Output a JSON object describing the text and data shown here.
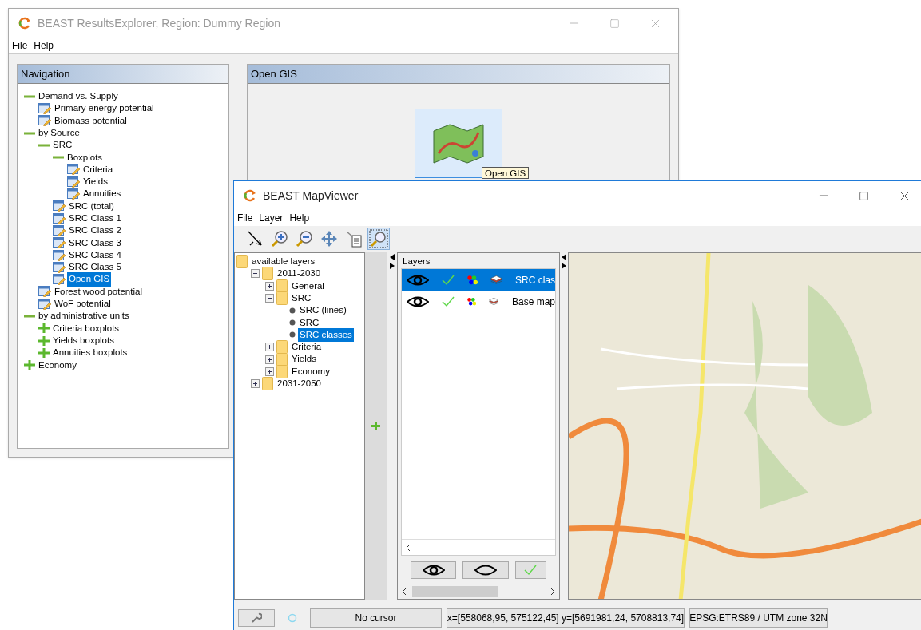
{
  "results_window": {
    "title": "BEAST ResultsExplorer, Region: Dummy Region",
    "menu": [
      "File",
      "Help"
    ],
    "navigation": {
      "title": "Navigation",
      "tree": [
        {
          "label": "Demand vs. Supply",
          "kind": "folder",
          "expanded": true,
          "selected": false,
          "children": [
            {
              "label": "Primary energy potential",
              "kind": "view",
              "selected": false
            },
            {
              "label": "Biomass potential",
              "kind": "view",
              "selected": false
            }
          ]
        },
        {
          "label": "by Source",
          "kind": "folder",
          "expanded": true,
          "selected": false,
          "children": [
            {
              "label": "SRC",
              "kind": "folder",
              "expanded": true,
              "selected": false,
              "children": [
                {
                  "label": "Boxplots",
                  "kind": "folder",
                  "expanded": true,
                  "selected": false,
                  "children": [
                    {
                      "label": "Criteria",
                      "kind": "view",
                      "selected": false
                    },
                    {
                      "label": "Yields",
                      "kind": "view",
                      "selected": false
                    },
                    {
                      "label": "Annuities",
                      "kind": "view",
                      "selected": false
                    }
                  ]
                },
                {
                  "label": "SRC (total)",
                  "kind": "view",
                  "selected": false
                },
                {
                  "label": "SRC Class 1",
                  "kind": "view",
                  "selected": false
                },
                {
                  "label": "SRC Class 2",
                  "kind": "view",
                  "selected": false
                },
                {
                  "label": "SRC Class 3",
                  "kind": "view",
                  "selected": false
                },
                {
                  "label": "SRC Class 4",
                  "kind": "view",
                  "selected": false
                },
                {
                  "label": "SRC Class 5",
                  "kind": "view",
                  "selected": false
                },
                {
                  "label": "Open GIS",
                  "kind": "view",
                  "selected": true
                }
              ]
            },
            {
              "label": "Forest wood potential",
              "kind": "view",
              "selected": false
            },
            {
              "label": "WoF potential",
              "kind": "view",
              "selected": false
            }
          ]
        },
        {
          "label": "by administrative units",
          "kind": "folder",
          "expanded": true,
          "selected": false,
          "children": [
            {
              "label": "Criteria boxplots",
              "kind": "folder",
              "expanded": false,
              "selected": false
            },
            {
              "label": "Yields boxplots",
              "kind": "folder",
              "expanded": false,
              "selected": false
            },
            {
              "label": "Annuities boxplots",
              "kind": "folder",
              "expanded": false,
              "selected": false
            }
          ]
        },
        {
          "label": "Economy",
          "kind": "folder",
          "expanded": false,
          "selected": false
        }
      ]
    },
    "open_gis": {
      "title": "Open GIS",
      "tooltip": "Open GIS"
    }
  },
  "map_window": {
    "title": "BEAST MapViewer",
    "menu": [
      "File",
      "Layer",
      "Help"
    ],
    "toolbar": [
      {
        "kind": "select",
        "selected": false
      },
      {
        "kind": "zoom-in",
        "selected": false
      },
      {
        "kind": "zoom-out",
        "selected": false
      },
      {
        "kind": "pan",
        "selected": false
      },
      {
        "kind": "info",
        "selected": false
      },
      {
        "kind": "zoom-extent",
        "selected": true
      }
    ],
    "layer_tree": [
      {
        "label": "available layers",
        "kind": "root",
        "selected": false,
        "children": [
          {
            "label": "2011-2030",
            "kind": "folder",
            "expanded": true,
            "selected": false,
            "children": [
              {
                "label": "General",
                "kind": "folder",
                "expanded": false,
                "selected": false
              },
              {
                "label": "SRC",
                "kind": "folder",
                "expanded": true,
                "selected": false,
                "children": [
                  {
                    "label": "SRC (lines)",
                    "kind": "leaf",
                    "selected": false
                  },
                  {
                    "label": "SRC",
                    "kind": "leaf",
                    "selected": false
                  },
                  {
                    "label": "SRC classes",
                    "kind": "leaf",
                    "selected": true
                  }
                ]
              },
              {
                "label": "Criteria",
                "kind": "folder",
                "expanded": false,
                "selected": false
              },
              {
                "label": "Yields",
                "kind": "folder",
                "expanded": false,
                "selected": false
              },
              {
                "label": "Economy",
                "kind": "folder",
                "expanded": false,
                "selected": false
              }
            ]
          },
          {
            "label": "2031-2050",
            "kind": "folder",
            "expanded": false,
            "selected": false
          }
        ]
      }
    ],
    "layers": {
      "title": "Layers",
      "rows": [
        {
          "name": "SRC clas",
          "visible": true,
          "checked": true,
          "selected": true
        },
        {
          "name": "Base map",
          "visible": true,
          "checked": true,
          "selected": false
        }
      ]
    },
    "status_bar": {
      "cursor": "No cursor",
      "extent": "x=[558068,95, 575122,45] y=[5691981,24, 5708813,74]",
      "crs": "EPSG:ETRS89 / UTM zone 32N"
    }
  }
}
